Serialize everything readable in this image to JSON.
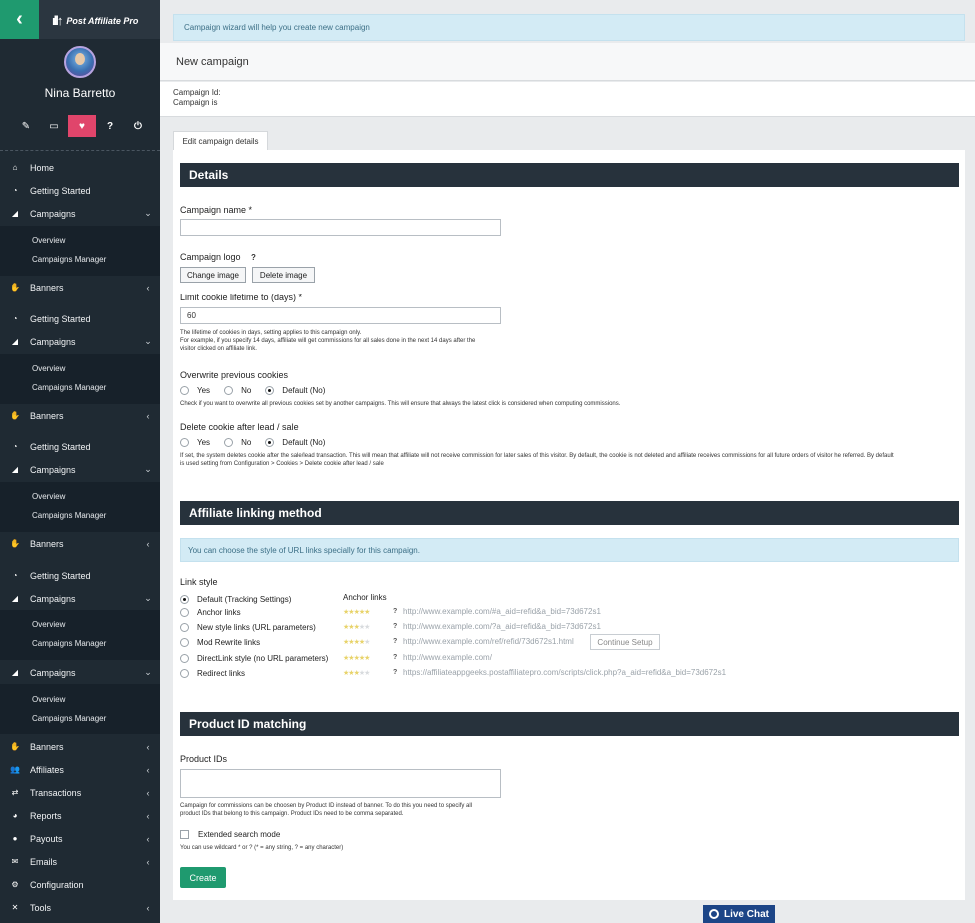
{
  "sidebar": {
    "logo_text": "Post Affiliate Pro",
    "user_name": "Nina Barretto",
    "nav": [
      {
        "label": "Home",
        "icon": "home-icon",
        "glyph": "⌂",
        "chev": ""
      },
      {
        "label": "Getting Started",
        "icon": "stopwatch-icon",
        "glyph": "◔",
        "chev": ""
      },
      {
        "label": "Campaigns",
        "icon": "campaigns-icon",
        "glyph": "◢",
        "chev": "⌄"
      },
      {
        "label": "Banners",
        "icon": "banners-icon",
        "glyph": "✋",
        "chev": "‹"
      },
      {
        "label": "Getting Started",
        "icon": "stopwatch-icon",
        "glyph": "◔",
        "chev": ""
      },
      {
        "label": "Campaigns",
        "icon": "campaigns-icon",
        "glyph": "◢",
        "chev": "⌄"
      },
      {
        "label": "Banners",
        "icon": "banners-icon",
        "glyph": "✋",
        "chev": "‹"
      },
      {
        "label": "Getting Started",
        "icon": "stopwatch-icon",
        "glyph": "◔",
        "chev": ""
      },
      {
        "label": "Campaigns",
        "icon": "campaigns-icon",
        "glyph": "◢",
        "chev": "⌄"
      },
      {
        "label": "Banners",
        "icon": "banners-icon",
        "glyph": "✋",
        "chev": "‹"
      },
      {
        "label": "Getting Started",
        "icon": "stopwatch-icon",
        "glyph": "◔",
        "chev": ""
      },
      {
        "label": "Campaigns",
        "icon": "campaigns-icon",
        "glyph": "◢",
        "chev": "⌄"
      },
      {
        "label": "Campaigns",
        "icon": "campaigns-icon",
        "glyph": "◢",
        "chev": "⌄"
      },
      {
        "label": "Banners",
        "icon": "banners-icon",
        "glyph": "✋",
        "chev": "‹"
      },
      {
        "label": "Affiliates",
        "icon": "affiliates-icon",
        "glyph": "👥",
        "chev": "‹"
      },
      {
        "label": "Transactions",
        "icon": "transactions-icon",
        "glyph": "⇄",
        "chev": "‹"
      },
      {
        "label": "Reports",
        "icon": "reports-icon",
        "glyph": "◕",
        "chev": "‹"
      },
      {
        "label": "Payouts",
        "icon": "payouts-icon",
        "glyph": "●",
        "chev": "‹"
      },
      {
        "label": "Emails",
        "icon": "emails-icon",
        "glyph": "✉",
        "chev": "‹"
      },
      {
        "label": "Configuration",
        "icon": "configuration-icon",
        "glyph": "⚙",
        "chev": ""
      },
      {
        "label": "Tools",
        "icon": "tools-icon",
        "glyph": "✕",
        "chev": "‹"
      }
    ],
    "sub": [
      "Overview",
      "Campaigns Manager"
    ]
  },
  "main": {
    "wizard_text": "Campaign wizard will help you create new campaign",
    "title": "New campaign",
    "campaign_id_label": "Campaign Id:",
    "campaign_is_label": "Campaign is",
    "tab_label": "Edit campaign details",
    "details_header": "Details",
    "campaign_name_label": "Campaign name *",
    "campaign_logo_label": "Campaign logo",
    "help_mark": "?",
    "change_image": "Change image",
    "delete_image": "Delete image",
    "cookie_label": "Limit cookie lifetime to (days) *",
    "cookie_value": "60",
    "cookie_hint_1": "The lifetime of cookies in days, setting applies to this campaign only.",
    "cookie_hint_2": "For example, if you specify 14 days, affiliate will get commissions for all sales done in the next 14 days after the",
    "cookie_hint_3": "visitor clicked on affiliate link.",
    "overwrite_label": "Overwrite previous cookies",
    "overwrite_hint": "Check if you want to overwrite all previous cookies set by another campaigns. This will ensure that always the latest click is considered when computing commissions.",
    "delete_cookie_label": "Delete cookie after lead / sale",
    "delete_cookie_hint_1": "If set, the system deletes cookie after the sale/lead transaction. This will mean that affiliate will not receive commission for later sales of this visitor. By default, the cookie is not deleted and affiliate receives commissions for all future orders of visitor he referred. By default",
    "delete_cookie_hint_2": "is used setting from Configuration > Cookies > Delete cookie after lead / sale",
    "opt_yes": "Yes",
    "opt_no": "No",
    "opt_default": "Default (No)",
    "linking_header": "Affiliate linking method",
    "linking_info": "You can choose the style of URL links specially for this campaign.",
    "link_style_label": "Link style",
    "anchor_links_caption": "Anchor links",
    "continue_setup": "Continue Setup",
    "link_styles": [
      {
        "label": "Default (Tracking Settings)",
        "stars": 0,
        "url": ""
      },
      {
        "label": "Anchor links",
        "stars": 5,
        "url": "http://www.example.com/#a_aid=refid&a_bid=73d672s1"
      },
      {
        "label": "New style links (URL parameters)",
        "stars": 3,
        "url": "http://www.example.com/?a_aid=refid&a_bid=73d672s1"
      },
      {
        "label": "Mod Rewrite links",
        "stars": 4,
        "url": "http://www.example.com/ref/refid/73d672s1.html"
      },
      {
        "label": "DirectLink style (no URL parameters)",
        "stars": 5,
        "url": "http://www.example.com/"
      },
      {
        "label": "Redirect links",
        "stars": 3,
        "url": "https://affiliateappgeeks.postaffiliatepro.com/scripts/click.php?a_aid=refid&a_bid=73d672s1"
      }
    ],
    "product_header": "Product ID matching",
    "product_ids_label": "Product IDs",
    "product_hint_1": "Campaign for commissions can be choosen by Product ID instead of banner. To do this you need to specify all",
    "product_hint_2": "product IDs that belong to this campaign. Product IDs need to be comma separated.",
    "extended_search": "Extended search mode",
    "wildcard_hint": "You can use wildcard * or ? (* = any string, ? = any character)",
    "create": "Create"
  },
  "live_chat": "Live Chat",
  "colors": {
    "accent": "#1f9a6f",
    "sidebar": "#1f2a33",
    "active_icon": "#e0456b",
    "header": "#27323c"
  }
}
